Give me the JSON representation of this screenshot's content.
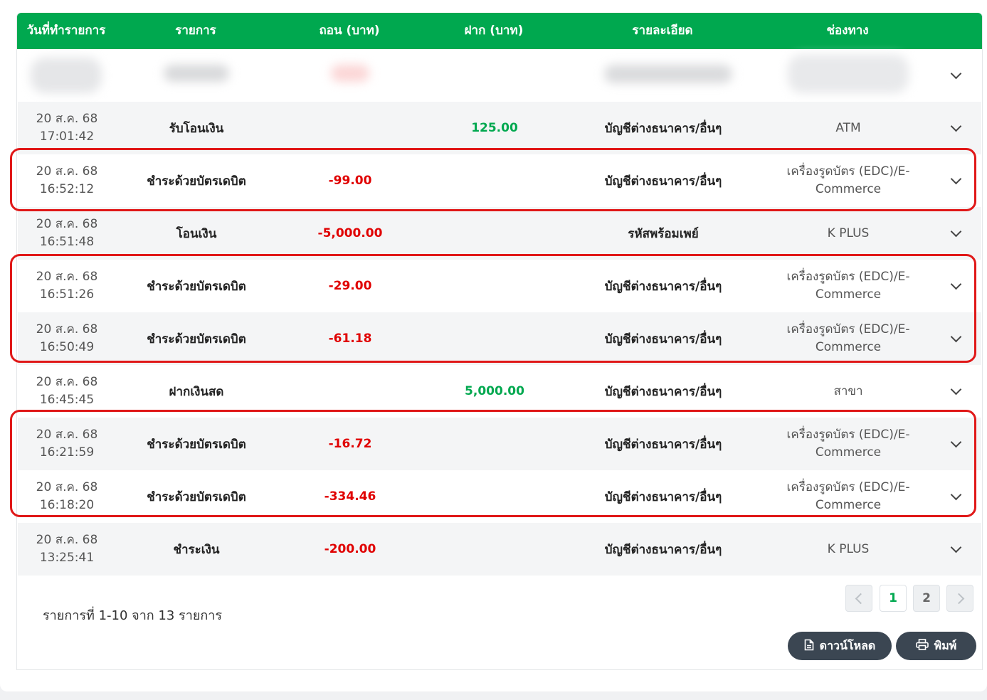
{
  "table": {
    "headers": {
      "date": "วันที่ทำรายการ",
      "item": "รายการ",
      "withdraw": "ถอน (บาท)",
      "deposit": "ฝาก (บาท)",
      "detail": "รายละเอียด",
      "channel": "ช่องทาง"
    },
    "rows": [
      {
        "date": "20 ส.ค. 68",
        "time": "17:01:42",
        "item": "รับโอนเงิน",
        "withdraw": "",
        "deposit": "125.00",
        "detail": "บัญชีต่างธนาคาร/อื่นๆ",
        "channel": "ATM"
      },
      {
        "date": "20 ส.ค. 68",
        "time": "16:52:12",
        "item": "ชำระด้วยบัตรเดบิต",
        "withdraw": "-99.00",
        "deposit": "",
        "detail": "บัญชีต่างธนาคาร/อื่นๆ",
        "channel": "เครื่องรูดบัตร (EDC)/E-Commerce"
      },
      {
        "date": "20 ส.ค. 68",
        "time": "16:51:48",
        "item": "โอนเงิน",
        "withdraw": "-5,000.00",
        "deposit": "",
        "detail": "รหัสพร้อมเพย์",
        "channel": "K PLUS"
      },
      {
        "date": "20 ส.ค. 68",
        "time": "16:51:26",
        "item": "ชำระด้วยบัตรเดบิต",
        "withdraw": "-29.00",
        "deposit": "",
        "detail": "บัญชีต่างธนาคาร/อื่นๆ",
        "channel": "เครื่องรูดบัตร (EDC)/E-Commerce"
      },
      {
        "date": "20 ส.ค. 68",
        "time": "16:50:49",
        "item": "ชำระด้วยบัตรเดบิต",
        "withdraw": "-61.18",
        "deposit": "",
        "detail": "บัญชีต่างธนาคาร/อื่นๆ",
        "channel": "เครื่องรูดบัตร (EDC)/E-Commerce"
      },
      {
        "date": "20 ส.ค. 68",
        "time": "16:45:45",
        "item": "ฝากเงินสด",
        "withdraw": "",
        "deposit": "5,000.00",
        "detail": "บัญชีต่างธนาคาร/อื่นๆ",
        "channel": "สาขา"
      },
      {
        "date": "20 ส.ค. 68",
        "time": "16:21:59",
        "item": "ชำระด้วยบัตรเดบิต",
        "withdraw": "-16.72",
        "deposit": "",
        "detail": "บัญชีต่างธนาคาร/อื่นๆ",
        "channel": "เครื่องรูดบัตร (EDC)/E-Commerce"
      },
      {
        "date": "20 ส.ค. 68",
        "time": "16:18:20",
        "item": "ชำระด้วยบัตรเดบิต",
        "withdraw": "-334.46",
        "deposit": "",
        "detail": "บัญชีต่างธนาคาร/อื่นๆ",
        "channel": "เครื่องรูดบัตร (EDC)/E-Commerce"
      },
      {
        "date": "20 ส.ค. 68",
        "time": "13:25:41",
        "item": "ชำระเงิน",
        "withdraw": "-200.00",
        "deposit": "",
        "detail": "บัญชีต่างธนาคาร/อื่นๆ",
        "channel": "K PLUS"
      }
    ]
  },
  "footer": {
    "summary": "รายการที่ 1-10 จาก 13 รายการ",
    "pages": [
      "1",
      "2"
    ],
    "download_label": "ดาวน์โหลด",
    "print_label": "พิมพ์"
  },
  "colors": {
    "header_green": "#00a84f",
    "withdraw_red": "#e00000",
    "deposit_green": "#00a84f",
    "highlight_red": "#e01818",
    "button_dark": "#3b4652"
  }
}
